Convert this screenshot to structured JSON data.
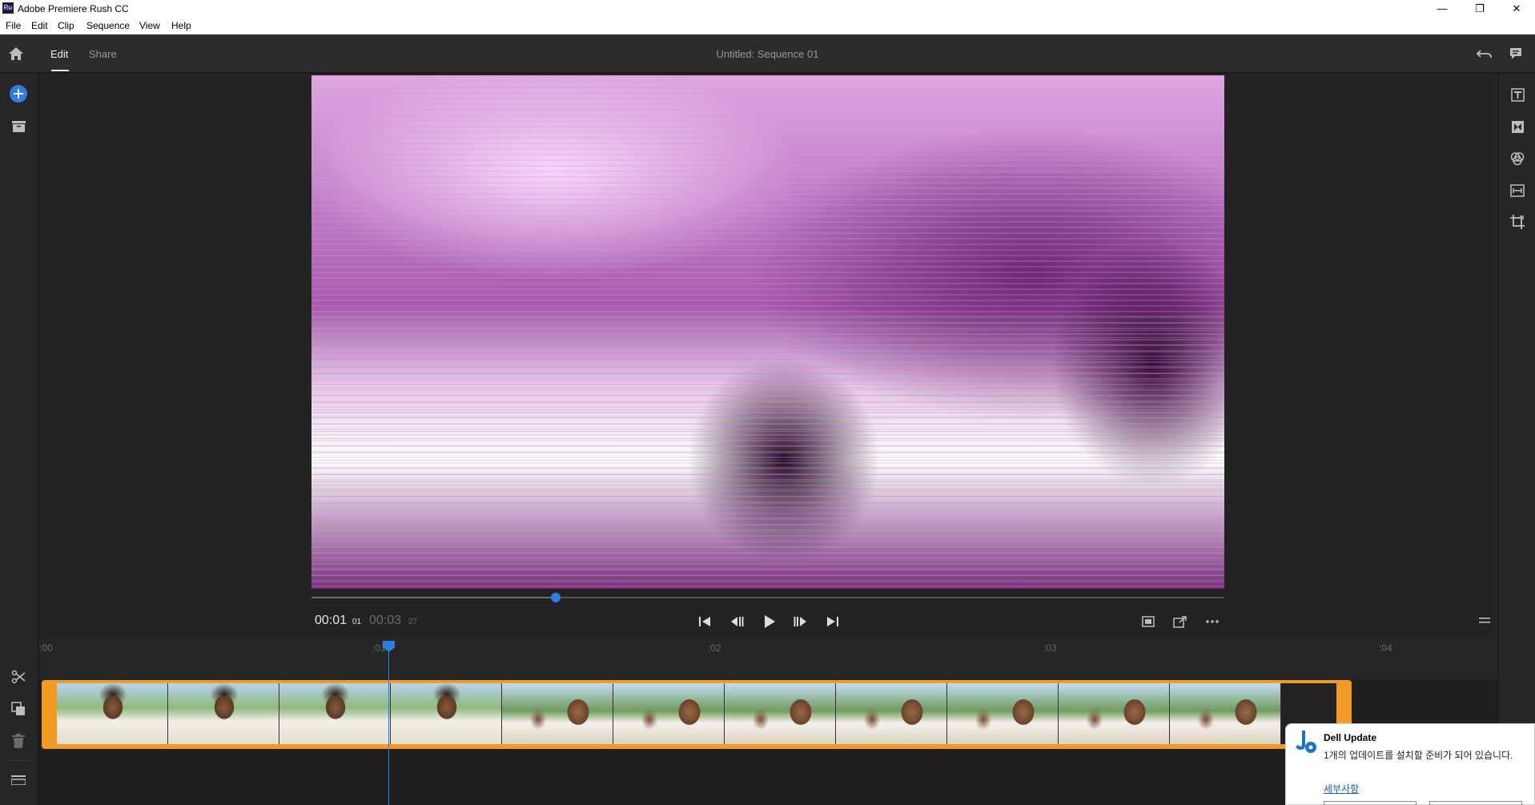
{
  "window": {
    "title": "Adobe Premiere Rush CC",
    "app_badge": "Ru",
    "minimize": "—",
    "maximize": "❐",
    "close": "✕"
  },
  "menu": [
    "File",
    "Edit",
    "Clip",
    "Sequence",
    "View",
    "Help"
  ],
  "header": {
    "tabs": [
      {
        "label": "Edit",
        "active": true
      },
      {
        "label": "Share",
        "active": false
      }
    ],
    "sequence_title": "Untitled: Sequence 01"
  },
  "left_toolbar": {
    "top": [
      "add-media-icon",
      "project-assets-icon"
    ],
    "bottom": [
      "split-scissors-icon",
      "duplicate-icon",
      "delete-trash-icon",
      "track-controls-icon"
    ]
  },
  "right_toolbar": [
    "titles-icon",
    "transitions-icon",
    "color-icon",
    "speed-icon",
    "transform-crop-icon"
  ],
  "player": {
    "current_time": "00:01",
    "current_frames": "01",
    "duration": "00:03",
    "duration_frames": "27",
    "playhead_fraction": 0.27,
    "controls": [
      "skip-to-start-icon",
      "step-back-icon",
      "play-icon",
      "step-forward-icon",
      "skip-to-end-icon"
    ],
    "right_controls": [
      "fit-icon",
      "export-frame-icon",
      "more-icon"
    ],
    "menu_icon": "hamburger-icon"
  },
  "timeline": {
    "ruler_labels": [
      ":00",
      ":01",
      ":02",
      ":03",
      ":04"
    ],
    "thumb_count": 11
  },
  "colors": {
    "accent_blue": "#2f7de1",
    "clip_orange": "#f29a26",
    "video_tint": "#b24fbe"
  },
  "notification": {
    "title": "Dell Update",
    "body": "1개의 업데이트를 설치할 준비가 되어 있습니다.",
    "link": "세부사항"
  }
}
